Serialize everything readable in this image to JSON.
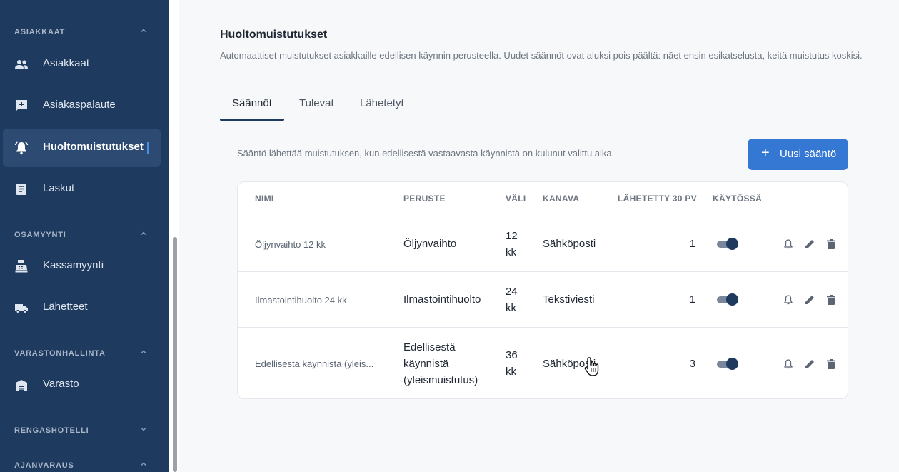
{
  "sidebar": {
    "sections": [
      {
        "title": "ASIAKKAAT"
      },
      {
        "title": "OSAMYYNTI"
      },
      {
        "title": "VARASTONHALLINTA"
      },
      {
        "title": "RENGASHOTELLI"
      },
      {
        "title": "AJANVARAUS"
      }
    ],
    "items": [
      {
        "label": "Asiakkaat",
        "icon": "people-icon"
      },
      {
        "label": "Asiakaspalaute",
        "icon": "feedback-icon"
      },
      {
        "label": "Huoltomuistutukset",
        "icon": "bell-icon"
      },
      {
        "label": "Laskut",
        "icon": "invoice-icon"
      },
      {
        "label": "Kassamyynti",
        "icon": "cash-register-icon"
      },
      {
        "label": "Lähetteet",
        "icon": "truck-icon"
      },
      {
        "label": "Varasto",
        "icon": "warehouse-icon"
      }
    ]
  },
  "page": {
    "title": "Huoltomuistutukset",
    "description": "Automaattiset muistutukset asiakkaille edellisen käynnin perusteella. Uudet säännöt ovat aluksi pois päältä: näet ensin esikatselusta, keitä muistutus koskisi."
  },
  "tabs": [
    {
      "label": "Säännöt"
    },
    {
      "label": "Tulevat"
    },
    {
      "label": "Lähetetyt"
    }
  ],
  "rules": {
    "note": "Sääntö lähettää muistutuksen, kun edellisestä vastaavasta käynnistä on kulunut valittu aika.",
    "new_button": "Uusi sääntö",
    "columns": [
      "NIMI",
      "PERUSTE",
      "VÄLI",
      "KANAVA",
      "LÄHETETTY 30 PV",
      "KÄYTÖSSÄ"
    ],
    "rows": [
      {
        "name": "Öljynvaihto 12 kk",
        "basis": "Öljynvaihto",
        "interval": "12 kk",
        "channel": "Sähköposti",
        "sent": "1",
        "enabled": true
      },
      {
        "name": "Ilmastointihuolto 24 kk",
        "basis": "Ilmastointihuolto",
        "interval": "24 kk",
        "channel": "Tekstiviesti",
        "sent": "1",
        "enabled": true
      },
      {
        "name": "Edellisestä käynnistä (yleis...",
        "basis": "Edellisestä käynnistä (yleismuistutus)",
        "interval": "36 kk",
        "channel": "Sähköposti",
        "sent": "3",
        "enabled": true
      }
    ]
  },
  "colors": {
    "sidebar_bg": "#1e3a5f",
    "accent": "#3478d4",
    "toggle_on": "#1e3a5f"
  }
}
